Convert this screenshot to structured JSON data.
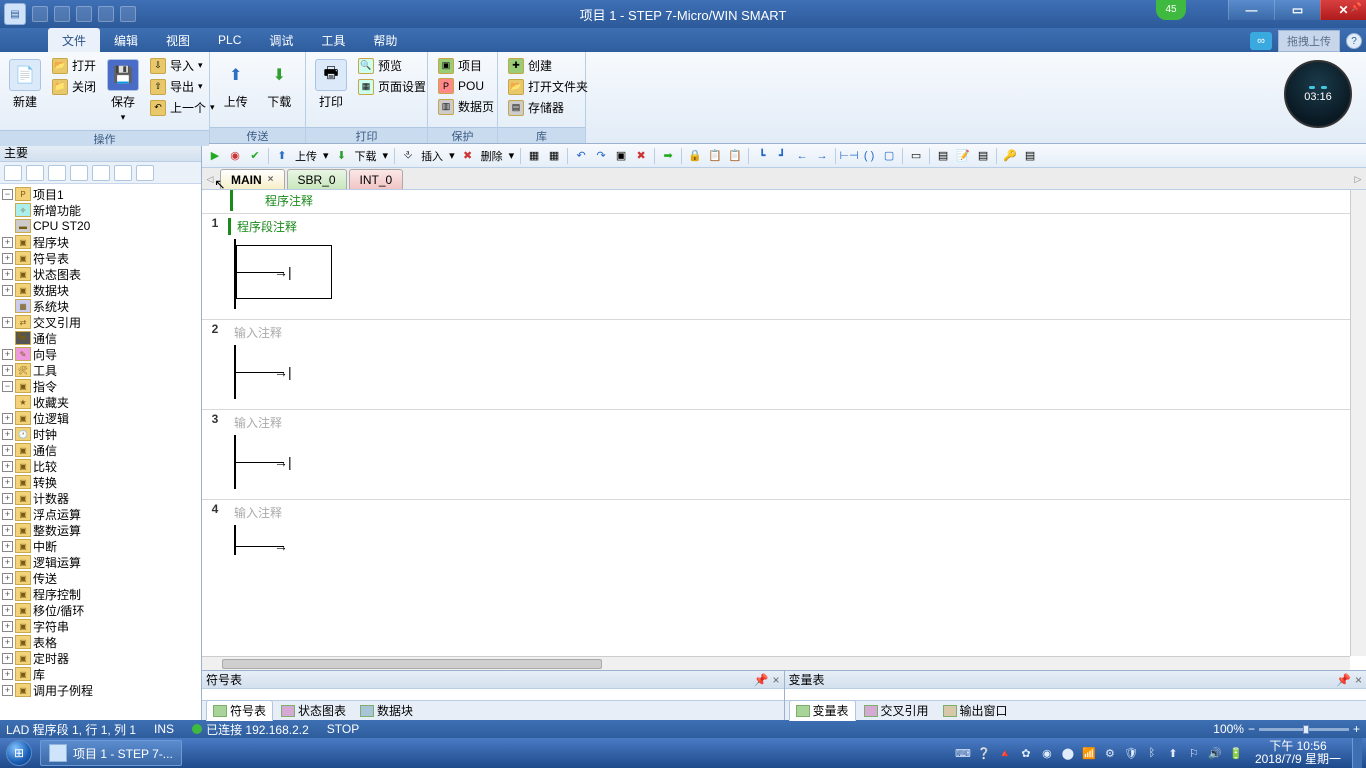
{
  "titlebar": {
    "title": "项目 1 - STEP 7-Micro/WIN SMART",
    "badge": "45"
  },
  "menu": {
    "file": "文件",
    "edit": "编辑",
    "view": "视图",
    "plc": "PLC",
    "debug": "调试",
    "tools": "工具",
    "help": "帮助",
    "upload_hint": "拖拽上传"
  },
  "ribbon": {
    "g1": {
      "label": "操作",
      "new": "新建",
      "open": "打开",
      "close": "关闭",
      "save": "保存",
      "import": "导入",
      "export": "导出",
      "prev": "上一个"
    },
    "g2": {
      "label": "传送",
      "up": "上传",
      "down": "下载"
    },
    "g3": {
      "label": "打印",
      "print": "打印",
      "preview": "预览",
      "pagesetup": "页面设置"
    },
    "g4": {
      "label": "保护",
      "project": "项目",
      "pou": "POU",
      "datapage": "数据页"
    },
    "g5": {
      "label": "库",
      "create": "创建",
      "openfolder": "打开文件夹",
      "storage": "存储器"
    },
    "clock": "03:16"
  },
  "sidepanel": {
    "title": "主要"
  },
  "tree": {
    "project": "项目1",
    "newfeat": "新增功能",
    "cpu": "CPU ST20",
    "progblk": "程序块",
    "symtab": "符号表",
    "statchart": "状态图表",
    "datablk": "数据块",
    "sysblk": "系统块",
    "xref": "交叉引用",
    "comm": "通信",
    "wizard": "向导",
    "tools": "工具",
    "instr": "指令",
    "fav": "收藏夹",
    "bitlogic": "位逻辑",
    "clock": "时钟",
    "comm2": "通信",
    "compare": "比较",
    "convert": "转换",
    "counter": "计数器",
    "float": "浮点运算",
    "int": "整数运算",
    "interrupt": "中断",
    "logic": "逻辑运算",
    "move": "传送",
    "progctrl": "程序控制",
    "shift": "移位/循环",
    "string": "字符串",
    "table": "表格",
    "timer": "定时器",
    "lib": "库",
    "subr": "调用子例程"
  },
  "toolbar2": {
    "upload": "上传",
    "download": "下载",
    "insert": "插入",
    "delete": "删除"
  },
  "tabs": {
    "main": "MAIN",
    "sbr": "SBR_0",
    "int": "INT_0"
  },
  "editor": {
    "progcomment": "程序注释",
    "net1comment": "程序段注释",
    "placeholder": "输入注释"
  },
  "bottom": {
    "left_title": "符号表",
    "right_title": "变量表",
    "lt1": "符号表",
    "lt2": "状态图表",
    "lt3": "数据块",
    "rt1": "变量表",
    "rt2": "交叉引用",
    "rt3": "输出窗口"
  },
  "status": {
    "pos": "LAD 程序段 1, 行 1, 列 1",
    "ins": "INS",
    "conn": "已连接 192.168.2.2",
    "mode": "STOP",
    "zoom": "100%"
  },
  "taskbar": {
    "app": "项目 1 - STEP 7-...",
    "time": "下午 10:56",
    "date": "2018/7/9 星期一"
  }
}
